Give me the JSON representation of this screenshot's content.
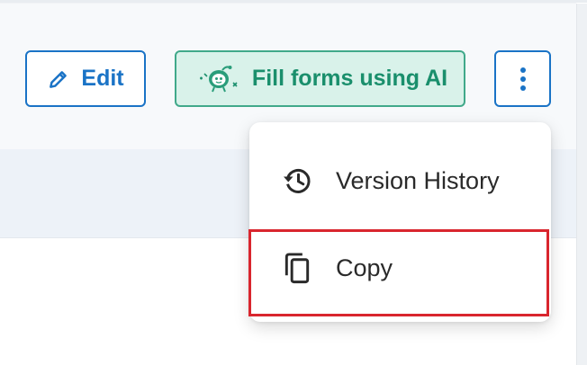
{
  "toolbar": {
    "edit_label": "Edit",
    "ai_label": "Fill forms using AI",
    "edit_icon": "pencil-icon",
    "ai_icon": "robot-mascot-icon",
    "more_icon": "vertical-ellipsis-icon"
  },
  "menu": {
    "items": [
      {
        "label": "Version History",
        "icon": "history-icon"
      },
      {
        "label": "Copy",
        "icon": "copy-icon"
      }
    ],
    "highlighted_item": "Copy"
  },
  "colors": {
    "primary_blue": "#1a73c6",
    "ai_green": "#1a8f6c",
    "ai_green_bg": "#d9f2ea",
    "highlight_red": "#d9262e"
  }
}
